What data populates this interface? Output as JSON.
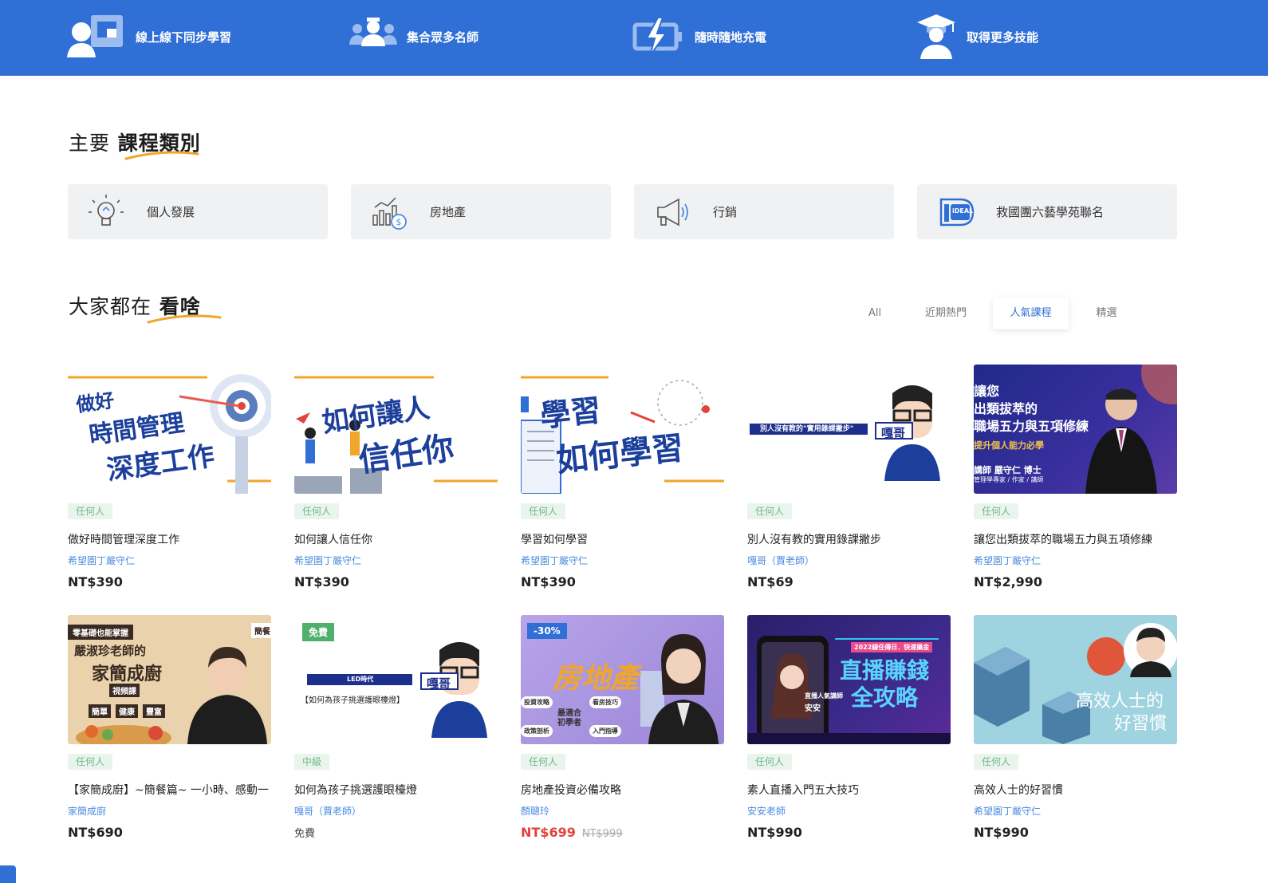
{
  "banner": {
    "features": [
      {
        "icon": "online-class-icon",
        "label": "線上線下同步學習"
      },
      {
        "icon": "teachers-group-icon",
        "label": "集合眾多名師"
      },
      {
        "icon": "battery-charge-icon",
        "label": "隨時隨地充電"
      },
      {
        "icon": "graduate-icon",
        "label": "取得更多技能"
      }
    ]
  },
  "categories_section": {
    "title_part1": "主要",
    "title_part2": "課程類別",
    "items": [
      {
        "icon": "lightbulb-icon",
        "label": "個人發展"
      },
      {
        "icon": "finance-chart-icon",
        "label": "房地產"
      },
      {
        "icon": "megaphone-icon",
        "label": "行銷"
      },
      {
        "icon": "ideal-logo-icon",
        "label": "救國團六藝學苑聯名",
        "logo_text": "iDEAL"
      }
    ]
  },
  "popular_section": {
    "title_part1": "大家都在",
    "title_part2": "看啥",
    "tabs": [
      "All",
      "近期熱門",
      "人氣課程",
      "精選"
    ],
    "active_tab": "人氣課程"
  },
  "courses": [
    {
      "thumb_text": [
        "做好",
        "時間管理",
        "深度工作"
      ],
      "level": "任何人",
      "title": "做好時間管理深度工作",
      "teacher": "希望園丁嚴守仁",
      "price": "NT$390"
    },
    {
      "thumb_text": [
        "如何讓人",
        "信任你"
      ],
      "level": "任何人",
      "title": "如何讓人信任你",
      "teacher": "希望園丁嚴守仁",
      "price": "NT$390"
    },
    {
      "thumb_text": [
        "學習",
        "如何學習"
      ],
      "level": "任何人",
      "title": "學習如何學習",
      "teacher": "希望園丁嚴守仁",
      "price": "NT$390"
    },
    {
      "thumb_text": [
        "別人沒有教的\"實用錄課撇步\"",
        "嘎哥"
      ],
      "level": "任何人",
      "title": "別人沒有教的實用錄課撇步",
      "teacher": "嘎哥（賈老師）",
      "price": "NT$69"
    },
    {
      "thumb_text": [
        "讓您",
        "出類拔萃的",
        "職場五力與五項修練",
        "提升個人能力必學",
        "講師 嚴守仁 博士",
        "管理學專家 / 作家 / 講師"
      ],
      "level": "任何人",
      "title": "讓您出類拔萃的職場五力與五項修練",
      "teacher": "希望園丁嚴守仁",
      "price": "NT$2,990"
    },
    {
      "thumb_text": [
        "零基礎也能掌握",
        "嚴淑珍老師的",
        "家簡成廚",
        "視頻課",
        "簡單",
        "健康",
        "豐富",
        "簡餐"
      ],
      "level": "任何人",
      "title": "【家簡成廚】~簡餐篇~ 一小時、感動一",
      "teacher": "家簡成廚",
      "price": "NT$690"
    },
    {
      "thumb_text": [
        "LED時代",
        "【如何為孩子挑選護眼檯燈】",
        "嘎哥"
      ],
      "badge": "免費",
      "level": "中級",
      "title": "如何為孩子挑選護眼檯燈",
      "teacher": "嘎哥（賈老師）",
      "price": "免費"
    },
    {
      "thumb_text": [
        "房地產",
        "投資攻略",
        "看房技巧",
        "最適合",
        "初學者",
        "政策剖析",
        "入門指導"
      ],
      "badge": "-30%",
      "level": "任何人",
      "title": "房地產投資必備攻略",
      "teacher": "顏聰玲",
      "price": "NT$699",
      "original_price": "NT$999"
    },
    {
      "thumb_text": [
        "直播賺錢",
        "全攻略",
        "直播人氣講師",
        "安安",
        "2022線任傳日．快速攝金"
      ],
      "level": "任何人",
      "title": "素人直播入門五大技巧",
      "teacher": "安安老師",
      "price": "NT$990"
    },
    {
      "thumb_text": [
        "高效人士的",
        "好習慣"
      ],
      "level": "任何人",
      "title": "高效人士的好習慣",
      "teacher": "希望園丁嚴守仁",
      "price": "NT$990"
    }
  ],
  "colors": {
    "brand_blue": "#2f6fd6",
    "accent_orange": "#f0a62a",
    "sale_red": "#e0443c",
    "level_green": "#6fb88b"
  }
}
